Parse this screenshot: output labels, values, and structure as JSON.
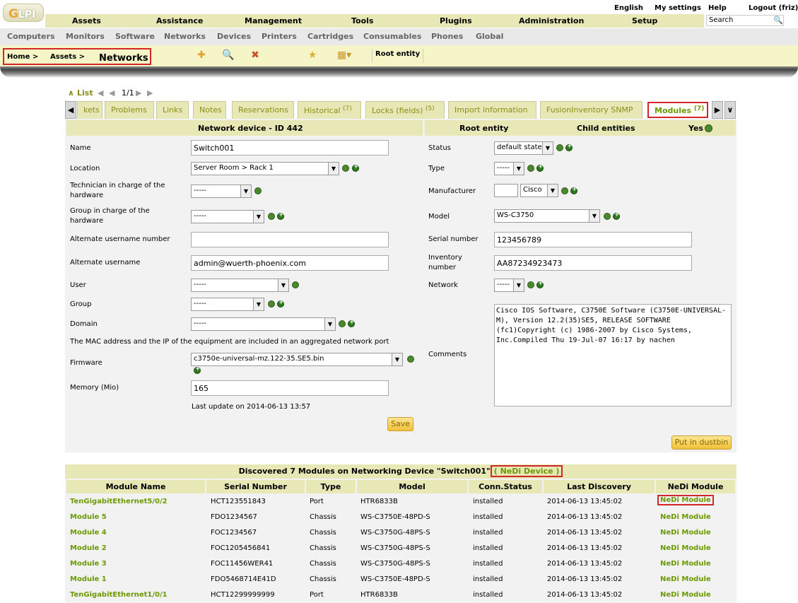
{
  "app": {
    "logo_text": "LPI",
    "logo_letter": "G"
  },
  "prefs": {
    "language": "English",
    "my_settings": "My settings",
    "help": "Help",
    "logout": "Logout (friz)"
  },
  "main_menu": [
    "Assets",
    "Assistance",
    "Management",
    "Tools",
    "Plugins",
    "Administration",
    "Setup"
  ],
  "search": {
    "placeholder": "Search"
  },
  "sub_menu": [
    "Computers",
    "Monitors",
    "Software",
    "Networks",
    "Devices",
    "Printers",
    "Cartridges",
    "Consumables",
    "Phones",
    "Global"
  ],
  "breadcrumb": {
    "home": "Home >",
    "assets": "Assets >",
    "current": "Networks"
  },
  "entity": "Root entity",
  "list_nav": {
    "label": "List",
    "page": "1/1"
  },
  "tabs": [
    {
      "label": "kets",
      "count": ""
    },
    {
      "label": "Problems",
      "count": ""
    },
    {
      "label": "Links",
      "count": ""
    },
    {
      "label": "Notes",
      "count": ""
    },
    {
      "label": "Reservations",
      "count": ""
    },
    {
      "label": "Historical",
      "count": "(7)"
    },
    {
      "label": "Locks (fields)",
      "count": "(5)"
    },
    {
      "label": "Import information",
      "count": ""
    },
    {
      "label": "FusionInventory SNMP",
      "count": ""
    },
    {
      "label": "Modules",
      "count": "(7)",
      "active": true
    }
  ],
  "form": {
    "title": "Network device - ID 442",
    "entity_header": "Root entity",
    "child_header": "Child entities",
    "child_value": "Yes",
    "name_label": "Name",
    "name_value": "Switch001",
    "location_label": "Location",
    "location_value": "Server Room > Rack 1",
    "tech_label": "Technician in charge of the hardware",
    "tech_value": "-----",
    "group_hw_label": "Group in charge of the hardware",
    "group_hw_value": "-----",
    "alt_num_label": "Alternate username number",
    "alt_num_value": "",
    "alt_user_label": "Alternate username",
    "alt_user_value": "admin@wuerth-phoenix.com",
    "user_label": "User",
    "user_value": "-----",
    "group_label": "Group",
    "group_value": "-----",
    "domain_label": "Domain",
    "domain_value": "-----",
    "mac_note": "The MAC address and the IP of the equipment are included in an aggregated network port",
    "firmware_label": "Firmware",
    "firmware_value": "c3750e-universal-mz.122-35.SE5.bin",
    "memory_label": "Memory (Mio)",
    "memory_value": "165",
    "last_update": "Last update on 2014-06-13 13:57",
    "status_label": "Status",
    "status_value": "default state",
    "type_label": "Type",
    "type_value": "-----",
    "manufacturer_label": "Manufacturer",
    "manufacturer_value": "Cisco",
    "model_label": "Model",
    "model_value": "WS-C3750",
    "serial_label": "Serial number",
    "serial_value": "123456789",
    "inventory_label": "Inventory number",
    "inventory_value": "AA87234923473",
    "network_label": "Network",
    "network_value": "-----",
    "comments_label": "Comments",
    "comments_value": "Cisco IOS Software, C3750E Software (C3750E-UNIVERSAL-M), Version 12.2(35)SE5, RELEASE SOFTWARE (fc1)Copyright (c) 1986-2007 by Cisco Systems, Inc.Compiled Thu 19-Jul-07 16:17 by nachen",
    "save_label": "Save",
    "dustbin_label": "Put in dustbin"
  },
  "modules": {
    "title": "Discovered 7 Modules on Networking Device \"Switch001\"",
    "nedi_device": "( NeDi Device )",
    "columns": [
      "Module Name",
      "Serial Number",
      "Type",
      "Model",
      "Conn.Status",
      "Last Discovery",
      "NeDi Module"
    ],
    "rows": [
      {
        "name": "TenGigabitEthernet5/0/2",
        "serial": "HCT123551843",
        "type": "Port",
        "model": "HTR6833B",
        "status": "installed",
        "last": "2014-06-13 13:45:02",
        "link": "NeDi Module"
      },
      {
        "name": "Module 5",
        "serial": "FDO1234567",
        "type": "Chassis",
        "model": "WS-C3750E-48PD-S",
        "status": "installed",
        "last": "2014-06-13 13:45:02",
        "link": "NeDi Module"
      },
      {
        "name": "Module 4",
        "serial": "FOC1234567",
        "type": "Chassis",
        "model": "WS-C3750G-48PS-S",
        "status": "installed",
        "last": "2014-06-13 13:45:02",
        "link": "NeDi Module"
      },
      {
        "name": "Module 2",
        "serial": "FOC1205456841",
        "type": "Chassis",
        "model": "WS-C3750G-48PS-S",
        "status": "installed",
        "last": "2014-06-13 13:45:02",
        "link": "NeDi Module"
      },
      {
        "name": "Module 3",
        "serial": "FOC11456WER41",
        "type": "Chassis",
        "model": "WS-C3750G-48PS-S",
        "status": "installed",
        "last": "2014-06-13 13:45:02",
        "link": "NeDi Module"
      },
      {
        "name": "Module 1",
        "serial": "FDO5468714E41D",
        "type": "Chassis",
        "model": "WS-C3750E-48PD-S",
        "status": "installed",
        "last": "2014-06-13 13:45:02",
        "link": "NeDi Module"
      },
      {
        "name": "TenGigabitEthernet1/0/1",
        "serial": "HCT12299999999",
        "type": "Port",
        "model": "HTR6833B",
        "status": "installed",
        "last": "2014-06-13 13:45:02",
        "link": "NeDi Module"
      }
    ]
  },
  "colors": {
    "accent_green": "#6c9a00",
    "header_bg": "#e8e8b6",
    "highlight_red": "#d3262b"
  }
}
